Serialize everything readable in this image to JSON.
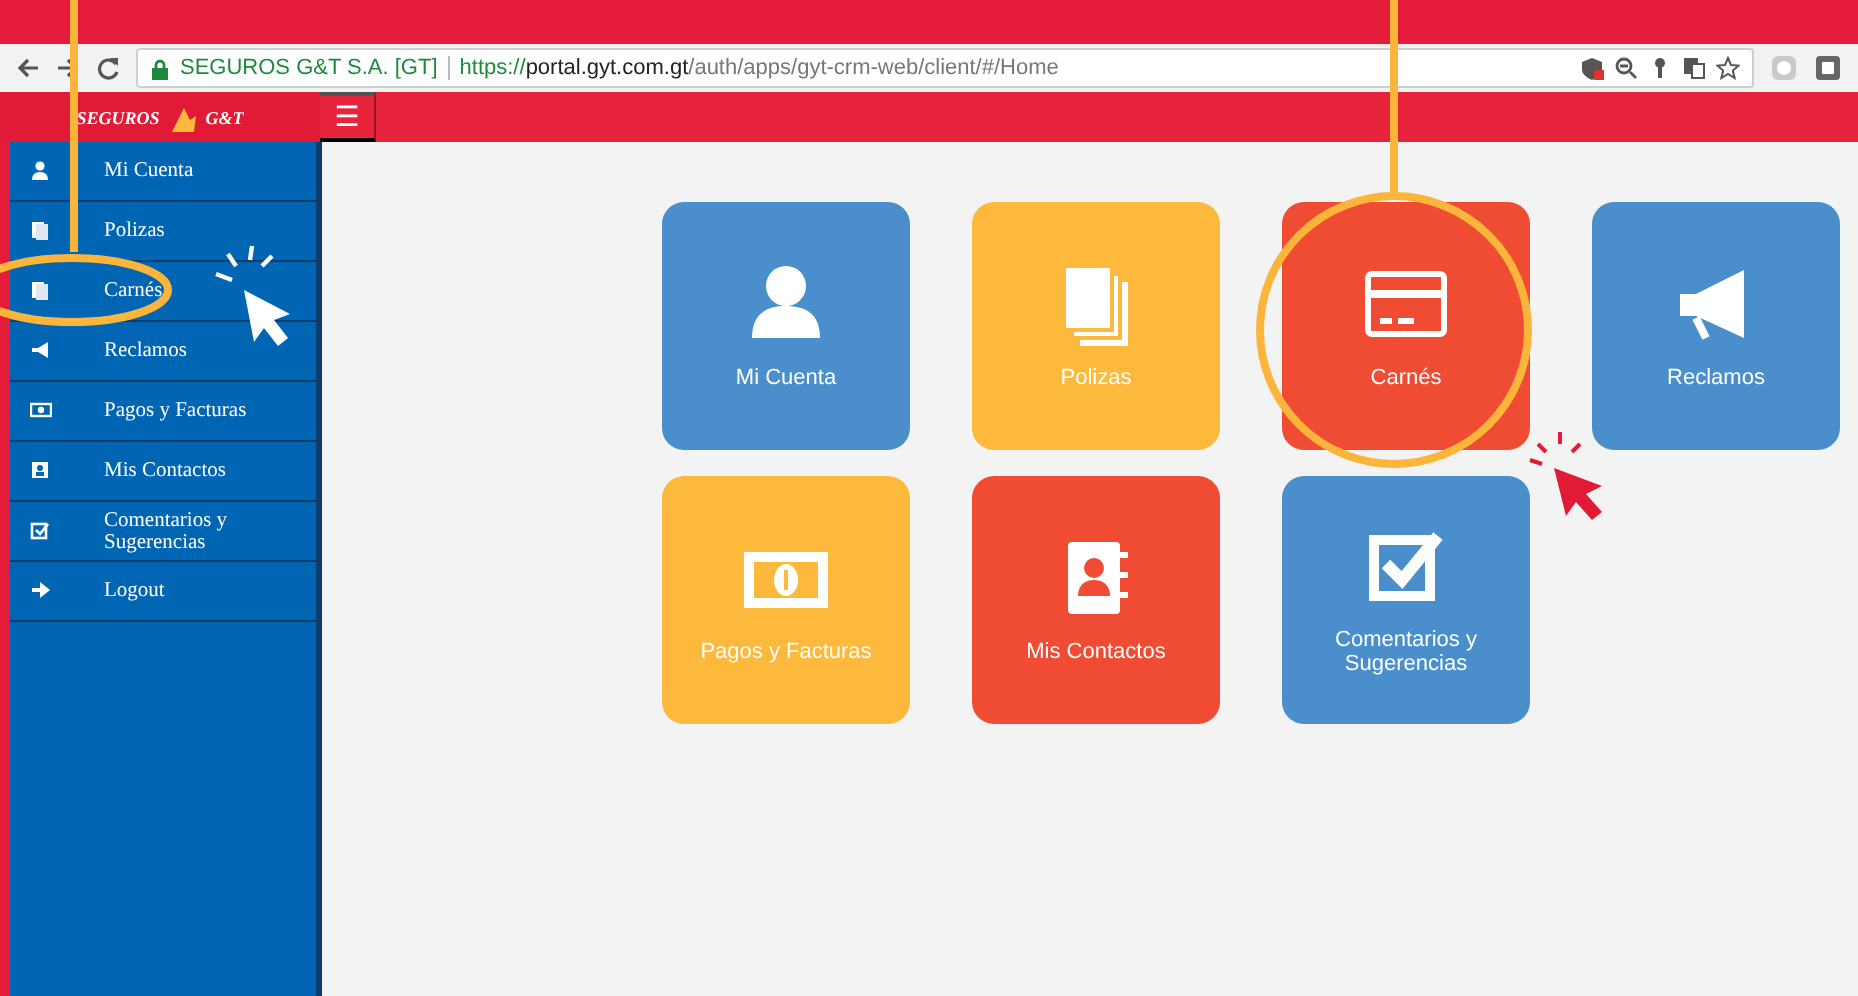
{
  "browser": {
    "site_identity": "SEGUROS G&T S.A. [GT]",
    "url_scheme": "https://",
    "url_host": "portal.gyt.com.gt",
    "url_path": "/auth/apps/gyt-crm-web/client/#/Home"
  },
  "header": {
    "logo_left": "SEGUROS",
    "logo_right": "G&T",
    "menu_glyph": "☰"
  },
  "sidebar": {
    "items": [
      {
        "label": "Mi Cuenta"
      },
      {
        "label": "Polizas"
      },
      {
        "label": "Carnés"
      },
      {
        "label": "Reclamos"
      },
      {
        "label": "Pagos y Facturas"
      },
      {
        "label": "Mis Contactos"
      },
      {
        "label": "Comentarios y Sugerencias"
      },
      {
        "label": "Logout"
      }
    ]
  },
  "tiles": [
    {
      "label": "Mi Cuenta",
      "color": "#4a8fcc"
    },
    {
      "label": "Polizas",
      "color": "#fdb93b"
    },
    {
      "label": "Carnés",
      "color": "#f04b33"
    },
    {
      "label": "Reclamos",
      "color": "#4a8fcc"
    },
    {
      "label": "Pagos y Facturas",
      "color": "#fdb93b"
    },
    {
      "label": "Mis Contactos",
      "color": "#f04b33"
    },
    {
      "label": "Comentarios y Sugerencias",
      "color": "#4a8fcc"
    }
  ]
}
